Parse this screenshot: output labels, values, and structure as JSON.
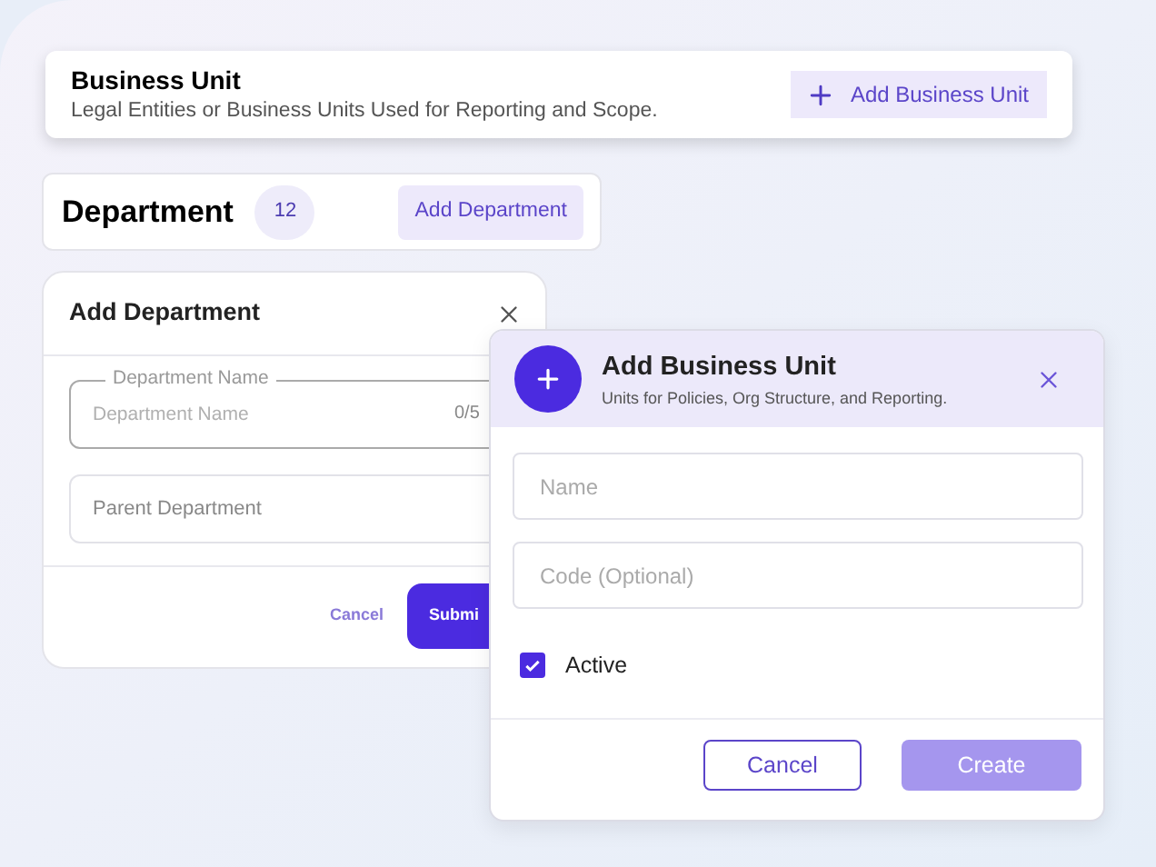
{
  "business_unit": {
    "title": "Business Unit",
    "subtitle": "Legal Entities or Business Units Used for Reporting and Scope.",
    "button": "Add Business Unit"
  },
  "department": {
    "title": "Department",
    "count": "12",
    "button": "Add Department"
  },
  "add_department_dialog": {
    "title": "Add Department",
    "fields": [
      {
        "label": "Department Name",
        "placeholder": "Department Name",
        "counter": "0/5"
      },
      {
        "placeholder": "Parent Department"
      }
    ],
    "cancel": "Cancel",
    "submit": "Submi"
  },
  "add_business_unit_dialog": {
    "title": "Add Business Unit",
    "subtitle": "Units for Policies, Org Structure, and Reporting.",
    "fields": [
      {
        "placeholder": "Name"
      },
      {
        "placeholder": "Code (Optional)"
      }
    ],
    "checkbox": {
      "label": "Active",
      "checked": true
    },
    "cancel": "Cancel",
    "create": "Create"
  }
}
